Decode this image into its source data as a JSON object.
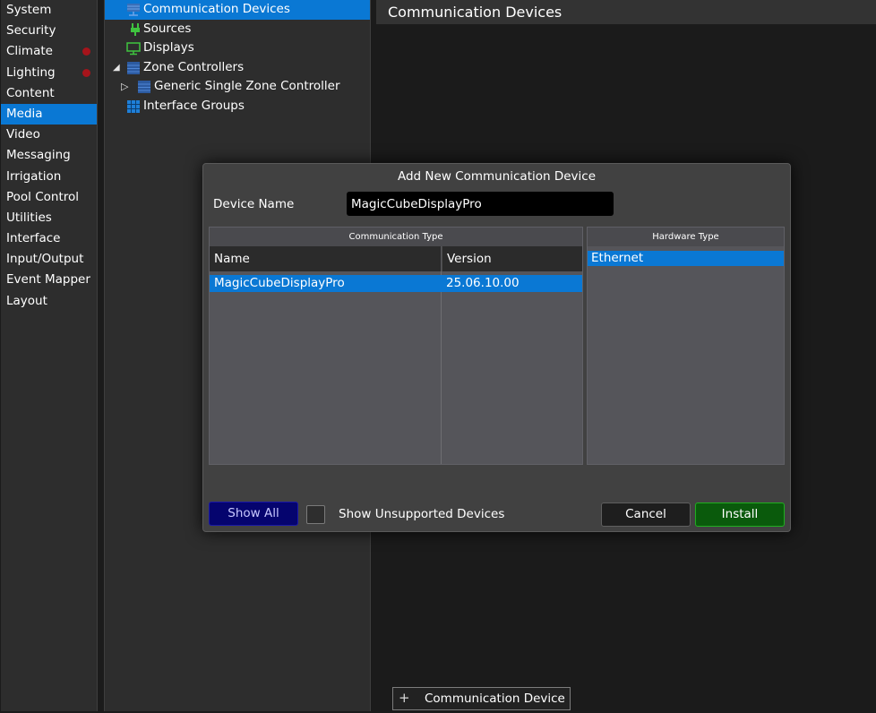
{
  "nav": {
    "items": [
      {
        "label": "System"
      },
      {
        "label": "Security"
      },
      {
        "label": "Climate"
      },
      {
        "label": "Lighting"
      },
      {
        "label": "Content"
      },
      {
        "label": "Media"
      },
      {
        "label": "Video"
      },
      {
        "label": "Messaging"
      },
      {
        "label": "Irrigation"
      },
      {
        "label": "Pool Control"
      },
      {
        "label": "Utilities"
      },
      {
        "label": "Interface"
      },
      {
        "label": "Input/Output"
      },
      {
        "label": "Event Mapper"
      },
      {
        "label": "Layout"
      }
    ],
    "active": "Media",
    "alert_items": [
      "Climate",
      "Lighting"
    ],
    "accent_color": "#0a78d4",
    "alert_color": "#a6141b"
  },
  "tree": {
    "items": [
      {
        "label": "Communication Devices",
        "icon": "network-icon",
        "selected": true
      },
      {
        "label": "Sources",
        "icon": "plug-icon"
      },
      {
        "label": "Displays",
        "icon": "monitor-icon"
      },
      {
        "label": "Zone Controllers",
        "icon": "zone-controller-icon",
        "expanded": true
      },
      {
        "label": "Generic Single Zone Controller",
        "icon": "zone-controller-icon",
        "collapsed": true
      },
      {
        "label": "Interface Groups",
        "icon": "grid-icon"
      }
    ]
  },
  "main": {
    "title": "Communication Devices",
    "add_button": {
      "icon": "plus-icon",
      "label": "Communication Device"
    }
  },
  "dialog": {
    "title": "Add New Communication Device",
    "device_name_label": "Device Name",
    "device_name_value": "MagicCubeDisplayPro",
    "communication_type": {
      "header": "Communication Type",
      "columns": [
        "Name",
        "Version"
      ],
      "rows": [
        {
          "name": "MagicCubeDisplayPro",
          "version": "25.06.10.00",
          "selected": true
        }
      ]
    },
    "hardware_type": {
      "header": "Hardware Type",
      "rows": [
        {
          "label": "Ethernet",
          "selected": true
        }
      ]
    },
    "show_all_label": "Show All",
    "show_unsupported_label": "Show Unsupported Devices",
    "show_unsupported_checked": false,
    "cancel_label": "Cancel",
    "install_label": "Install"
  }
}
